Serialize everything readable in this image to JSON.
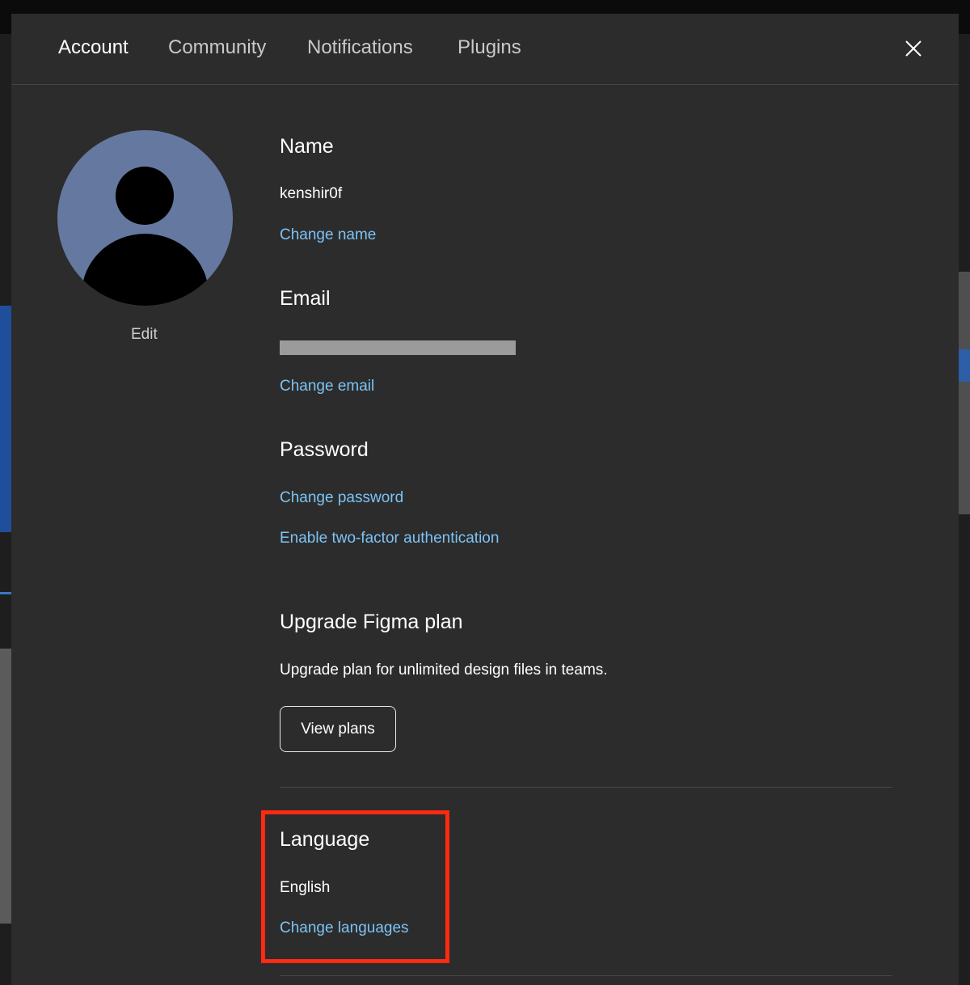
{
  "tabs": [
    {
      "label": "Account",
      "active": true
    },
    {
      "label": "Community",
      "active": false
    },
    {
      "label": "Notifications",
      "active": false
    },
    {
      "label": "Plugins",
      "active": false
    }
  ],
  "close": {
    "icon": "close-icon"
  },
  "avatar": {
    "icon": "user-avatar-icon",
    "color": "#6578a0",
    "edit_label": "Edit"
  },
  "name": {
    "heading": "Name",
    "value": "kenshir0f",
    "link": "Change name"
  },
  "email": {
    "heading": "Email",
    "value_redacted": true,
    "link": "Change email"
  },
  "password": {
    "heading": "Password",
    "link_change": "Change password",
    "link_2fa": "Enable two-factor authentication"
  },
  "upgrade": {
    "heading": "Upgrade Figma plan",
    "description": "Upgrade plan for unlimited design files in teams.",
    "button": "View plans"
  },
  "language": {
    "heading": "Language",
    "value": "English",
    "link": "Change languages"
  },
  "colors": {
    "accent_link": "#7cc3f5",
    "highlight": "#ff2a10",
    "modal_bg": "#2c2c2c"
  }
}
